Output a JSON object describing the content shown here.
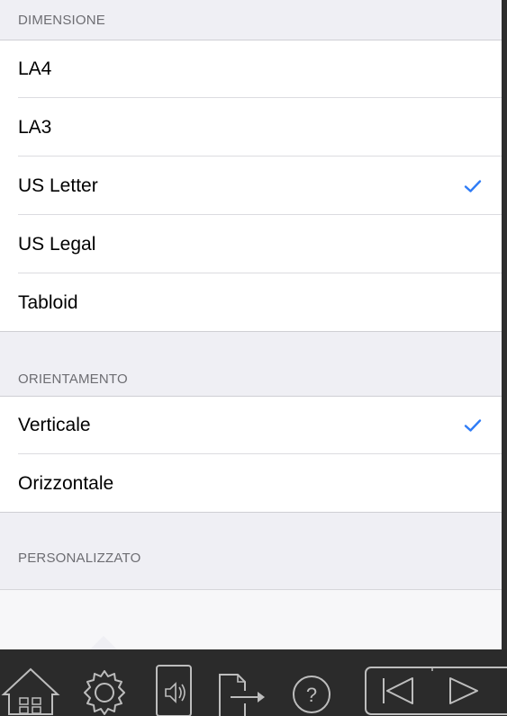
{
  "sections": {
    "dimensione": {
      "header": "DIMENSIONE",
      "items": [
        {
          "label": "LA4",
          "checked": false
        },
        {
          "label": "LA3",
          "checked": false
        },
        {
          "label": "US Letter",
          "checked": true
        },
        {
          "label": "US Legal",
          "checked": false
        },
        {
          "label": "Tabloid",
          "checked": false
        }
      ]
    },
    "orientamento": {
      "header": "ORIENTAMENTO",
      "items": [
        {
          "label": "Verticale",
          "checked": true
        },
        {
          "label": "Orizzontale",
          "checked": false
        }
      ]
    },
    "personalizzato": {
      "header": "PERSONALIZZATO"
    }
  },
  "colors": {
    "accent": "#2f7cf6",
    "background": "#efeff4",
    "toolbar": "#2b2b2b",
    "toolbar_icon": "#bdbdbd"
  },
  "toolbar": {
    "icons": [
      "home-icon",
      "gear-icon",
      "device-audio-icon",
      "export-icon",
      "help-icon",
      "first-page-icon",
      "play-icon"
    ]
  }
}
